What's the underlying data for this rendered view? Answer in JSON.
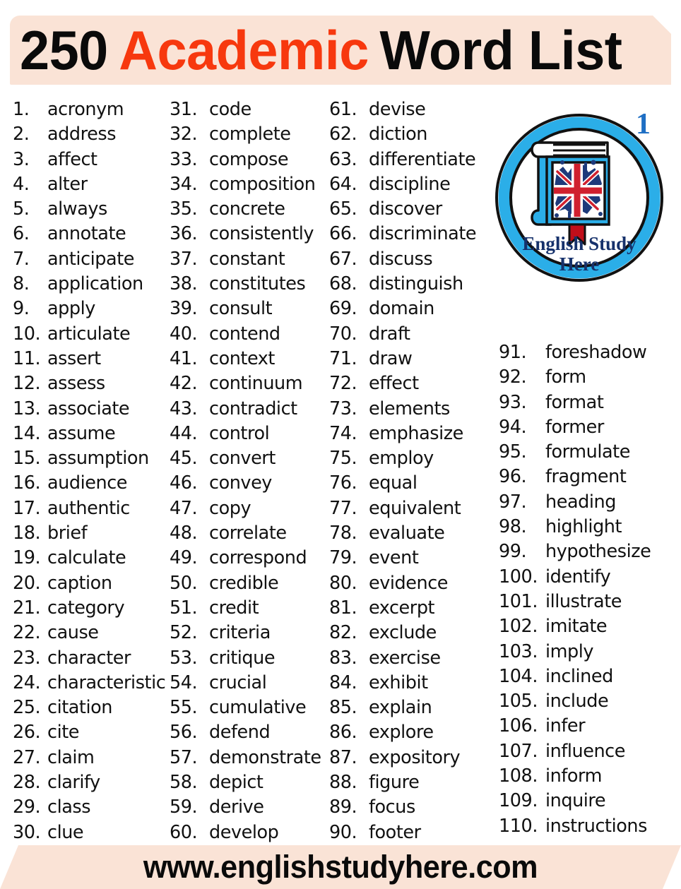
{
  "header": {
    "count": "250",
    "highlight": "Academic",
    "rest": "Word List"
  },
  "badge": {
    "number": "1",
    "brand_line1": "English Study",
    "brand_line2": "Here",
    "icon": "book-with-uk-flag-icon",
    "ring_color": "#2BAEE8",
    "text_color": "#16316B",
    "bookmark_color": "#C10E1A"
  },
  "footer": {
    "url": "www.englishstudyhere.com"
  },
  "colors": {
    "banner_bg": "#FAE3D6",
    "accent_red": "#F7380E",
    "badge_blue": "#1F6FC4",
    "text": "#111111"
  },
  "columns": [
    {
      "id": "col-1",
      "items": [
        {
          "num": "1.",
          "word": "acronym"
        },
        {
          "num": "2.",
          "word": "address"
        },
        {
          "num": "3.",
          "word": "affect"
        },
        {
          "num": "4.",
          "word": "alter"
        },
        {
          "num": "5.",
          "word": "always"
        },
        {
          "num": "6.",
          "word": "annotate"
        },
        {
          "num": "7.",
          "word": "anticipate"
        },
        {
          "num": "8.",
          "word": "application"
        },
        {
          "num": "9.",
          "word": "apply"
        },
        {
          "num": "10.",
          "word": "articulate"
        },
        {
          "num": "11.",
          "word": "assert"
        },
        {
          "num": "12.",
          "word": "assess"
        },
        {
          "num": "13.",
          "word": "associate"
        },
        {
          "num": "14.",
          "word": "assume"
        },
        {
          "num": "15.",
          "word": "assumption"
        },
        {
          "num": "16.",
          "word": "audience"
        },
        {
          "num": "17.",
          "word": "authentic"
        },
        {
          "num": "18.",
          "word": "brief"
        },
        {
          "num": "19.",
          "word": "calculate"
        },
        {
          "num": "20.",
          "word": "caption"
        },
        {
          "num": "21.",
          "word": "category"
        },
        {
          "num": "22.",
          "word": "cause"
        },
        {
          "num": "23.",
          "word": "character"
        },
        {
          "num": "24.",
          "word": "characteristic"
        },
        {
          "num": "25.",
          "word": "citation"
        },
        {
          "num": "26.",
          "word": "cite"
        },
        {
          "num": "27.",
          "word": "claim"
        },
        {
          "num": "28.",
          "word": "clarify"
        },
        {
          "num": "29.",
          "word": "class"
        },
        {
          "num": "30.",
          "word": "clue"
        }
      ]
    },
    {
      "id": "col-2",
      "items": [
        {
          "num": "31.",
          "word": "code"
        },
        {
          "num": "32.",
          "word": "complete"
        },
        {
          "num": "33.",
          "word": "compose"
        },
        {
          "num": "34.",
          "word": "composition"
        },
        {
          "num": "35.",
          "word": "concrete"
        },
        {
          "num": "36.",
          "word": "consistently"
        },
        {
          "num": "37.",
          "word": "constant"
        },
        {
          "num": "38.",
          "word": "constitutes"
        },
        {
          "num": "39.",
          "word": "consult"
        },
        {
          "num": "40.",
          "word": "contend"
        },
        {
          "num": "41.",
          "word": "context"
        },
        {
          "num": "42.",
          "word": "continuum"
        },
        {
          "num": "43.",
          "word": "contradict"
        },
        {
          "num": "44.",
          "word": "control"
        },
        {
          "num": "45.",
          "word": "convert"
        },
        {
          "num": "46.",
          "word": "convey"
        },
        {
          "num": "47.",
          "word": "copy"
        },
        {
          "num": "48.",
          "word": "correlate"
        },
        {
          "num": "49.",
          "word": "correspond"
        },
        {
          "num": "50.",
          "word": "credible"
        },
        {
          "num": "51.",
          "word": "credit"
        },
        {
          "num": "52.",
          "word": "criteria"
        },
        {
          "num": "53.",
          "word": "critique"
        },
        {
          "num": "54.",
          "word": "crucial"
        },
        {
          "num": "55.",
          "word": "cumulative"
        },
        {
          "num": "56.",
          "word": "defend"
        },
        {
          "num": "57.",
          "word": "demonstrate"
        },
        {
          "num": "58.",
          "word": "depict"
        },
        {
          "num": "59.",
          "word": "derive"
        },
        {
          "num": "60.",
          "word": "develop"
        }
      ]
    },
    {
      "id": "col-3",
      "items": [
        {
          "num": "61.",
          "word": "devise"
        },
        {
          "num": "62.",
          "word": "diction"
        },
        {
          "num": "63.",
          "word": "differentiate"
        },
        {
          "num": "64.",
          "word": "discipline"
        },
        {
          "num": "65.",
          "word": "discover"
        },
        {
          "num": "66.",
          "word": "discriminate"
        },
        {
          "num": "67.",
          "word": "discuss"
        },
        {
          "num": "68.",
          "word": "distinguish"
        },
        {
          "num": "69.",
          "word": "domain"
        },
        {
          "num": "70.",
          "word": "draft"
        },
        {
          "num": "71.",
          "word": "draw"
        },
        {
          "num": "72.",
          "word": "effect"
        },
        {
          "num": "73.",
          "word": "elements"
        },
        {
          "num": "74.",
          "word": "emphasize"
        },
        {
          "num": "75.",
          "word": "employ"
        },
        {
          "num": "76.",
          "word": "equal"
        },
        {
          "num": "77.",
          "word": "equivalent"
        },
        {
          "num": "78.",
          "word": "evaluate"
        },
        {
          "num": "79.",
          "word": "event"
        },
        {
          "num": "80.",
          "word": "evidence"
        },
        {
          "num": "81.",
          "word": "excerpt"
        },
        {
          "num": "82.",
          "word": "exclude"
        },
        {
          "num": "83.",
          "word": "exercise"
        },
        {
          "num": "84.",
          "word": "exhibit"
        },
        {
          "num": "85.",
          "word": "explain"
        },
        {
          "num": "86.",
          "word": "explore"
        },
        {
          "num": "87.",
          "word": "expository"
        },
        {
          "num": "88.",
          "word": "figure"
        },
        {
          "num": "89.",
          "word": "focus"
        },
        {
          "num": "90.",
          "word": "footer"
        }
      ]
    },
    {
      "id": "col-4",
      "items": [
        {
          "num": "91.",
          "word": "foreshadow"
        },
        {
          "num": "92.",
          "word": "form"
        },
        {
          "num": "93.",
          "word": "format"
        },
        {
          "num": "94.",
          "word": "former"
        },
        {
          "num": "95.",
          "word": "formulate"
        },
        {
          "num": "96.",
          "word": "fragment"
        },
        {
          "num": "97.",
          "word": "heading"
        },
        {
          "num": "98.",
          "word": "highlight"
        },
        {
          "num": "99.",
          "word": "hypothesize"
        },
        {
          "num": "100.",
          "word": "identify"
        },
        {
          "num": "101.",
          "word": "illustrate"
        },
        {
          "num": "102.",
          "word": "imitate"
        },
        {
          "num": "103.",
          "word": "imply"
        },
        {
          "num": "104.",
          "word": "inclined"
        },
        {
          "num": "105.",
          "word": "include"
        },
        {
          "num": "106.",
          "word": "infer"
        },
        {
          "num": "107.",
          "word": "influence"
        },
        {
          "num": "108.",
          "word": "inform"
        },
        {
          "num": "109.",
          "word": "inquire"
        },
        {
          "num": "110.",
          "word": "instructions"
        }
      ]
    }
  ]
}
